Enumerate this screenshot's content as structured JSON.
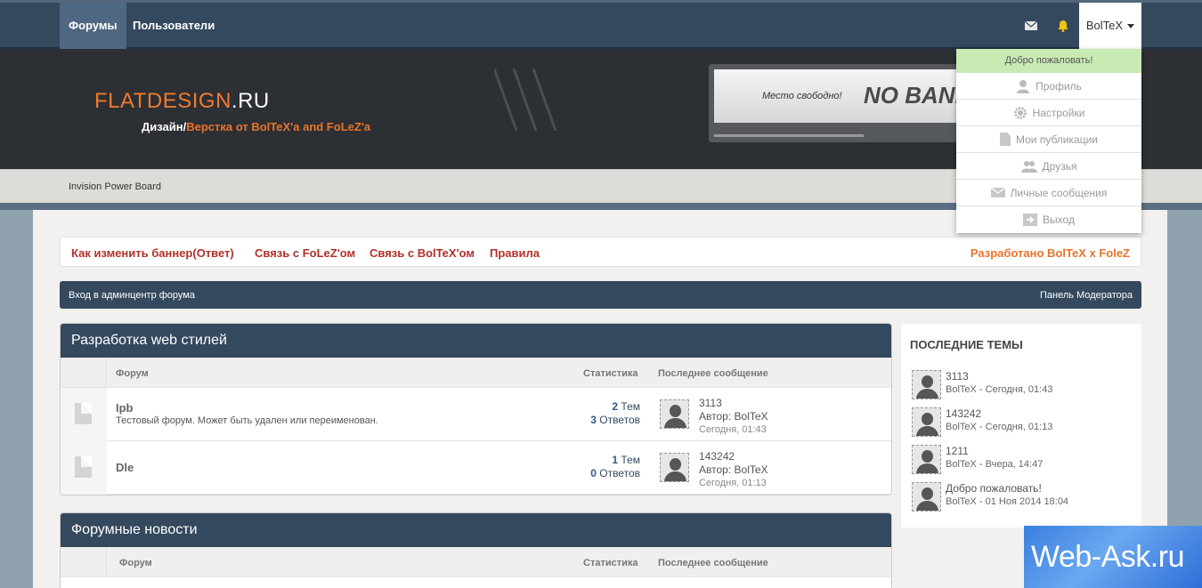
{
  "topbar": {
    "tabs": [
      {
        "label": "Форумы"
      },
      {
        "label": "Пользователи"
      }
    ],
    "user": "BolTeX"
  },
  "header": {
    "logo_main": "FLATDESIGN",
    "logo_ru": ".RU",
    "slogan_prefix": "Дизайн/",
    "slogan_accent": "Верстка от BolTeX'a and FoLeZ'a",
    "banner_small": "Место свободно!",
    "banner_big": "NO BANNER"
  },
  "subbar": {
    "text": "Invision Power Board"
  },
  "links": [
    {
      "label": "Как изменить баннер(Ответ)"
    },
    {
      "label": "Связь с FoLeZ'ом"
    },
    {
      "label": "Связь с BolTeX'ом"
    },
    {
      "label": "Правила"
    }
  ],
  "developer": "Разработано BolTeX x FoleZ",
  "adminbar": {
    "left": "Вход в админцентр форума",
    "right": "Панель Модератора"
  },
  "categories": [
    {
      "title": "Разработка web стилей",
      "head": {
        "forum": "Форум",
        "stats": "Статистика",
        "last": "Последнее сообщение"
      },
      "rows": [
        {
          "name": "Ipb",
          "desc": "Тестовый форум. Может быть удален или переименован.",
          "topics": "2",
          "topics_label": "Тем",
          "replies": "3",
          "replies_label": "Ответов",
          "last_title": "3113",
          "author_label": "Автор:",
          "author": "BolTeX",
          "date": "Сегодня, 01:43"
        },
        {
          "name": "Dle",
          "desc": "",
          "topics": "1",
          "topics_label": "Тем",
          "replies": "0",
          "replies_label": "Ответов",
          "last_title": "143242",
          "author_label": "Автор:",
          "author": "BolTeX",
          "date": "Сегодня, 01:13"
        }
      ]
    },
    {
      "title": "Форумные новости",
      "head": {
        "forum": "Форум",
        "stats": "Статистика",
        "last": "Последнее сообщение"
      }
    }
  ],
  "sidebar": {
    "title": "ПОСЛЕДНИЕ ТЕМЫ",
    "topics": [
      {
        "title": "3113",
        "meta": "BolTeX - Сегодня, 01:43"
      },
      {
        "title": "143242",
        "meta": "BolTeX - Сегодня, 01:13"
      },
      {
        "title": "1211",
        "meta": "BolTeX - Вчера, 14:47"
      },
      {
        "title": "Добро пожаловать!",
        "meta": "BolTeX - 01 Ноя 2014 18:04"
      }
    ]
  },
  "dropdown": {
    "welcome": "Добро пожаловать!",
    "items": [
      {
        "label": "Профиль",
        "icon": "user-icon"
      },
      {
        "label": "Настройки",
        "icon": "gear-icon"
      },
      {
        "label": "Мои публикации",
        "icon": "document-icon"
      },
      {
        "label": "Друзья",
        "icon": "users-icon"
      },
      {
        "label": "Личные сообщения",
        "icon": "envelope-icon"
      },
      {
        "label": "Выход",
        "icon": "logout-icon"
      }
    ]
  },
  "watermark": "Web-Ask.ru",
  "colors": {
    "navy": "#34495e",
    "accent_orange": "#e8742c",
    "link_red": "#b0312a",
    "welcome_green": "#c9eab2"
  }
}
